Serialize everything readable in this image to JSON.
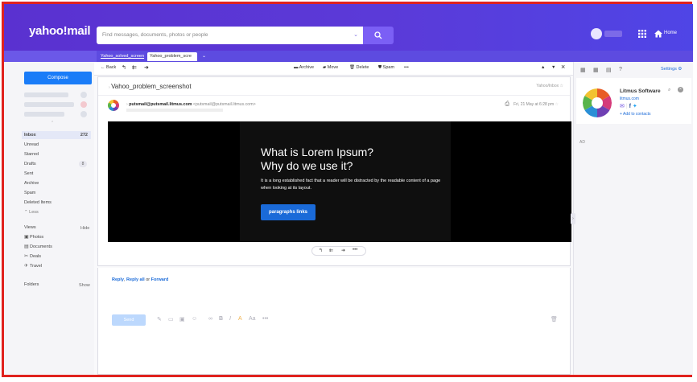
{
  "app": {
    "logo": "yahoo!mail"
  },
  "search": {
    "placeholder": "Find messages, documents, photos or people"
  },
  "header": {
    "home_label": "Home"
  },
  "tabs": [
    {
      "label": "Yahoo_solved_screen"
    },
    {
      "label": "Yahoo_problem_scre"
    }
  ],
  "sidebar": {
    "compose_label": "Compose",
    "folders": [
      {
        "label": "Inbox",
        "count": "272"
      },
      {
        "label": "Unread"
      },
      {
        "label": "Starred"
      },
      {
        "label": "Drafts",
        "count": "8"
      },
      {
        "label": "Sent"
      },
      {
        "label": "Archive"
      },
      {
        "label": "Spam"
      },
      {
        "label": "Deleted Items"
      }
    ],
    "less_label": "Less",
    "views_label": "Views",
    "hide_label": "Hide",
    "views": [
      {
        "label": "Photos",
        "icon": "photo-icon"
      },
      {
        "label": "Documents",
        "icon": "document-icon"
      },
      {
        "label": "Deals",
        "icon": "scissors-icon"
      },
      {
        "label": "Travel",
        "icon": "plane-icon"
      }
    ],
    "folders_label": "Folders",
    "show_label": "Show"
  },
  "toolbar": {
    "back_label": "Back",
    "archive_label": "Archive",
    "move_label": "Move",
    "delete_label": "Delete",
    "spam_label": "Spam"
  },
  "message": {
    "subject": "Vahoo_problem_screenshot",
    "folder": "Yahoo/Inbox",
    "sender_name": "putsmail@putsmail.litmus.com",
    "sender_addr": "<putsmail@putsmail.litmus.com>",
    "date": "Fri, 21 May at 6:28 pm",
    "body_title_line1": "What is Lorem Ipsum?",
    "body_title_line2": "Why do we use it?",
    "body_text": "It is a long established fact that a reader will be distracted by the readable content of a page when looking at its layout.",
    "body_button": "paragraphs links"
  },
  "reply": {
    "reply_label": "Reply",
    "reply_all_label": "Reply all",
    "or_label": "or",
    "forward_label": "Forward",
    "send_label": "Send"
  },
  "contact_panel": {
    "settings_label": "Settings",
    "name": "Litmus Software",
    "url": "litmus.com",
    "add_label": "+ Add to contacts",
    "ad_label": "AD"
  },
  "colors": {
    "header_gradient_start": "#5a31d0",
    "header_gradient_end": "#4f45e6",
    "accent_blue": "#1a7cf8",
    "frame_red": "#e0221e"
  }
}
